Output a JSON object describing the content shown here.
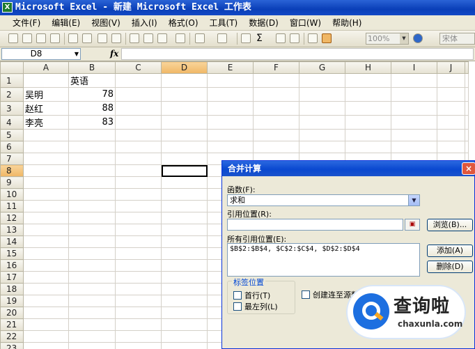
{
  "window": {
    "title": "Microsoft Excel - 新建 Microsoft Excel 工作表",
    "app_icon": "excel-icon"
  },
  "menu": [
    "文件(F)",
    "编辑(E)",
    "视图(V)",
    "插入(I)",
    "格式(O)",
    "工具(T)",
    "数据(D)",
    "窗口(W)",
    "帮助(H)"
  ],
  "toolbar": {
    "zoom": "100%",
    "font": "宋体",
    "sum_symbol": "Σ"
  },
  "formula_bar": {
    "name_box": "D8",
    "fx": "fx",
    "content": ""
  },
  "sheet": {
    "columns": [
      "A",
      "B",
      "C",
      "D",
      "E",
      "F",
      "G",
      "H",
      "I",
      "J"
    ],
    "rows": [
      "1",
      "2",
      "3",
      "4",
      "5",
      "6",
      "7",
      "8",
      "9",
      "10",
      "11",
      "12",
      "13",
      "14",
      "15",
      "16",
      "17",
      "18",
      "19",
      "20",
      "21",
      "22",
      "23"
    ],
    "cells": {
      "B1": "英语",
      "A2": "吴明",
      "B2": "78",
      "A3": "赵红",
      "B3": "88",
      "A4": "李亮",
      "B4": "83"
    },
    "active_cell": "D8"
  },
  "dialog": {
    "title": "合并计算",
    "close": "×",
    "function_label": "函数(F):",
    "function_value": "求和",
    "reference_label": "引用位置(R):",
    "reference_value": "",
    "browse_button": "浏览(B)...",
    "all_references_label": "所有引用位置(E):",
    "all_references": [
      "$B$2:$B$4, $C$2:$C$4, $D$2:$D$4"
    ],
    "add_button": "添加(A)",
    "delete_button": "删除(D)",
    "label_group": "标签位置",
    "top_row": "首行(T)",
    "left_column": "最左列(L)",
    "link_source": "创建连至源数"
  },
  "watermark": {
    "name": "查询啦",
    "url": "chaxunla.com"
  }
}
